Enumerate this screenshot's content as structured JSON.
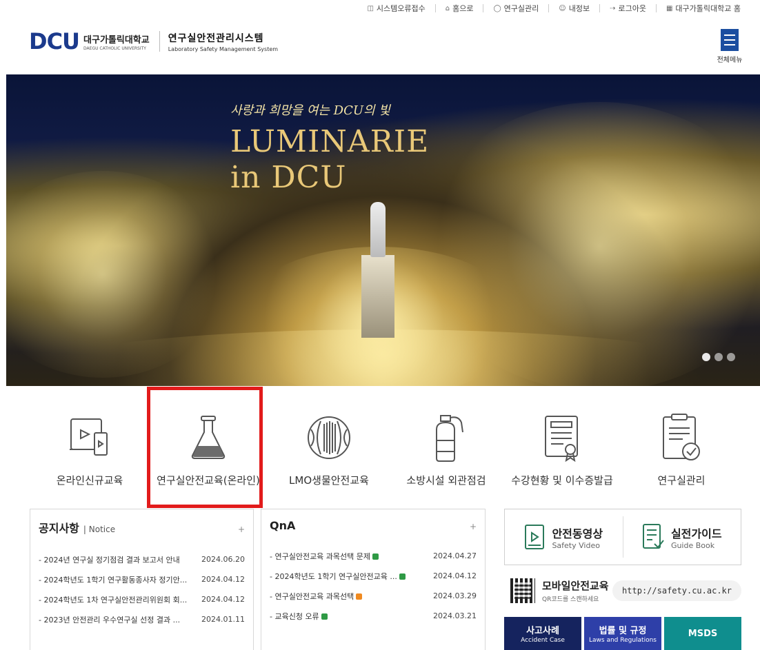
{
  "top_util": [
    {
      "icon": "monitor-icon",
      "label": "시스템오류접수"
    },
    {
      "icon": "home-icon",
      "label": "홈으로"
    },
    {
      "icon": "lab-icon",
      "label": "연구실관리"
    },
    {
      "icon": "user-icon",
      "label": "내정보"
    },
    {
      "icon": "logout-icon",
      "label": "로그아웃"
    },
    {
      "icon": "building-icon",
      "label": "대구가톨릭대학교 홈"
    }
  ],
  "brand": {
    "logo_text": "DCU",
    "univ_ko": "대구가톨릭대학교",
    "univ_en": "DAEGU CATHOLIC UNIVERSITY",
    "system_ko": "연구실안전관리시스템",
    "system_en": "Laboratory Safety Management System"
  },
  "menu": {
    "label": "전체메뉴"
  },
  "hero": {
    "subtitle": "사랑과 희망을 여는 DCU의 빛",
    "title_line1": "LUMINARIE",
    "title_line2": "in DCU"
  },
  "quick_links": [
    {
      "icon": "online-education-icon",
      "label": "온라인신규교육"
    },
    {
      "icon": "flask-icon",
      "label": "연구실안전교육(온라인)"
    },
    {
      "icon": "dna-icon",
      "label": "LMO생물안전교육"
    },
    {
      "icon": "fire-extinguisher-icon",
      "label": "소방시설 외관점검"
    },
    {
      "icon": "certificate-icon",
      "label": "수강현황 및 이수증발급"
    },
    {
      "icon": "clipboard-check-icon",
      "label": "연구실관리"
    }
  ],
  "notice": {
    "title": "공지사항",
    "subtitle": "| Notice",
    "more": "+",
    "items": [
      {
        "text": "- 2024년 연구실 정기점검 결과 보고서 안내",
        "date": "2024.06.20"
      },
      {
        "text": "- 2024학년도 1학기 연구활동종사자 정기안...",
        "date": "2024.04.12"
      },
      {
        "text": "- 2024학년도 1차 연구실안전관리위원회 회...",
        "date": "2024.04.12"
      },
      {
        "text": "- 2023년 안전관리 우수연구실 선정 결과 ...",
        "date": "2024.01.11"
      }
    ]
  },
  "qna": {
    "title": "QnA",
    "more": "+",
    "items": [
      {
        "text": "- 연구실안전교육 과목선택 문제",
        "lock": "open",
        "date": "2024.04.27"
      },
      {
        "text": "- 2024학년도 1학기 연구실안전교육 ...",
        "lock": "open",
        "date": "2024.04.12"
      },
      {
        "text": "- 연구실안전교육 과목선택",
        "lock": "closed",
        "date": "2024.03.29"
      },
      {
        "text": "- 교육신청 오류",
        "lock": "open",
        "date": "2024.03.21"
      }
    ]
  },
  "side": {
    "video_ko": "안전동영상",
    "video_en": "Safety Video",
    "guide_ko": "실전가이드",
    "guide_en": "Guide Book",
    "mobile_ko": "모바일안전교육",
    "mobile_en": "QR코드를 스캔하세요",
    "url": "http://safety.cu.ac.kr"
  },
  "bottom_buttons": [
    {
      "ko": "사고사례",
      "en": "Accident Case",
      "color": "#15235e"
    },
    {
      "ko": "법률 및 규정",
      "en": "Laws and Regulations",
      "color": "#2e3fa8"
    },
    {
      "ko": "MSDS",
      "en": "",
      "color": "#0f8e8e"
    }
  ]
}
